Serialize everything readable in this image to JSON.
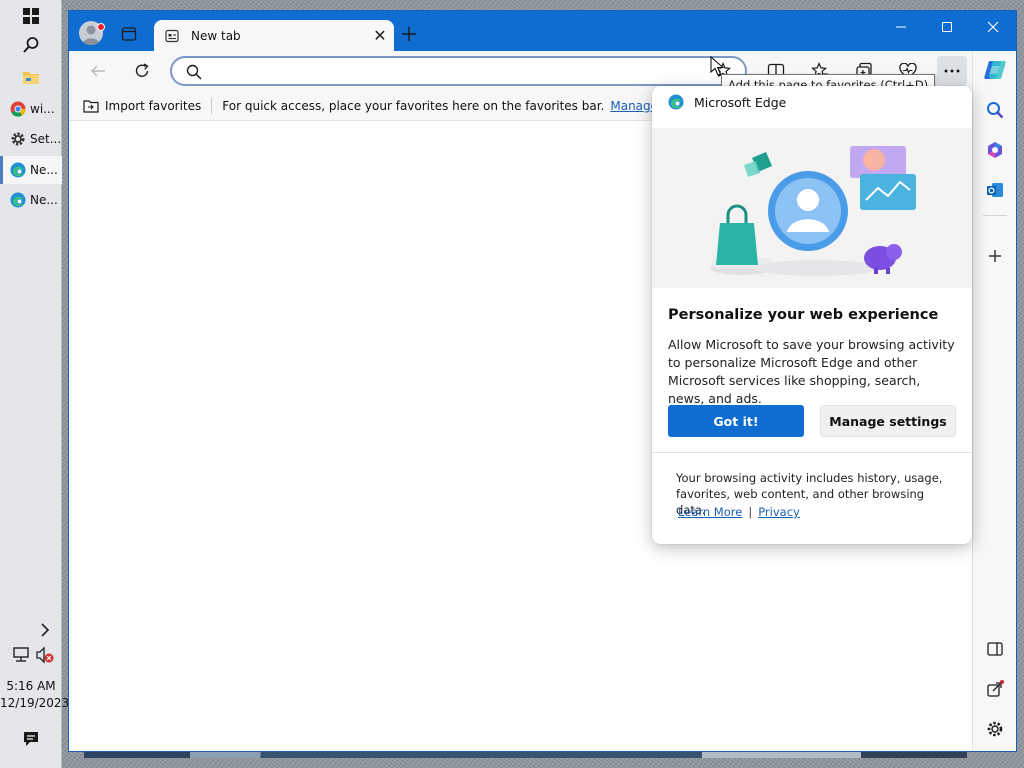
{
  "taskbar": {
    "start_icon": "windows-start-icon",
    "search_icon": "search-icon",
    "explorer_icon": "file-explorer-icon",
    "apps": [
      {
        "label": "wi...",
        "icon": "chrome-icon"
      },
      {
        "label": "Set...",
        "icon": "gear-icon"
      },
      {
        "label": "Ne...",
        "icon": "edge-icon"
      },
      {
        "label": "Ne...",
        "icon": "edge-icon"
      }
    ],
    "chevron_icon": "chevron-right-icon",
    "network_icon": "network-icon",
    "volume_icon": "volume-muted-icon",
    "time": "5:16 AM",
    "date": "12/19/2023",
    "notifications_icon": "notification-icon"
  },
  "browser": {
    "tab": {
      "title": "New tab",
      "close_symbol": "✕"
    },
    "address": {
      "value": "",
      "placeholder": ""
    },
    "favorites_bar": {
      "import_label": "Import favorites",
      "hint": "For quick access, place your favorites here on the favorites bar.",
      "manage_link": "Manage favorites"
    },
    "tooltip": "Add this page to favorites (Ctrl+D)",
    "accent_color": "#0f6cd0"
  },
  "flyout": {
    "app_name": "Microsoft Edge",
    "title": "Personalize your web experience",
    "body": "Allow Microsoft to save your browsing activity to personalize Microsoft Edge and other Microsoft services like shopping, search, news, and ads.",
    "primary_button": "Got it!",
    "secondary_button": "Manage settings",
    "footer": "Your browsing activity includes history, usage, favorites, web content, and other browsing data.",
    "learn_more": "Learn More",
    "separator": "|",
    "privacy": "Privacy"
  }
}
